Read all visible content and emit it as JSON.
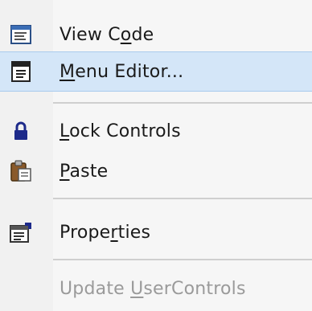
{
  "menu": {
    "items": [
      {
        "pre": "View C",
        "ul": "o",
        "post": "de",
        "icon": "view-code-icon",
        "enabled": true
      },
      {
        "pre": "",
        "ul": "M",
        "post": "enu Editor...",
        "icon": "menu-editor-icon",
        "enabled": true,
        "highlighted": true
      },
      {
        "pre": "",
        "ul": "L",
        "post": "ock Controls",
        "icon": "lock-icon",
        "enabled": true
      },
      {
        "pre": "",
        "ul": "P",
        "post": "aste",
        "icon": "paste-icon",
        "enabled": true
      },
      {
        "pre": "Prope",
        "ul": "r",
        "post": "ties",
        "icon": "properties-icon",
        "enabled": true
      },
      {
        "pre": "Update ",
        "ul": "U",
        "post": "serControls",
        "icon": "",
        "enabled": false
      }
    ],
    "colors": {
      "highlight": "#d4e6f8",
      "disabled_text": "#9a9a9a",
      "separator": "#cfcfcf"
    }
  }
}
